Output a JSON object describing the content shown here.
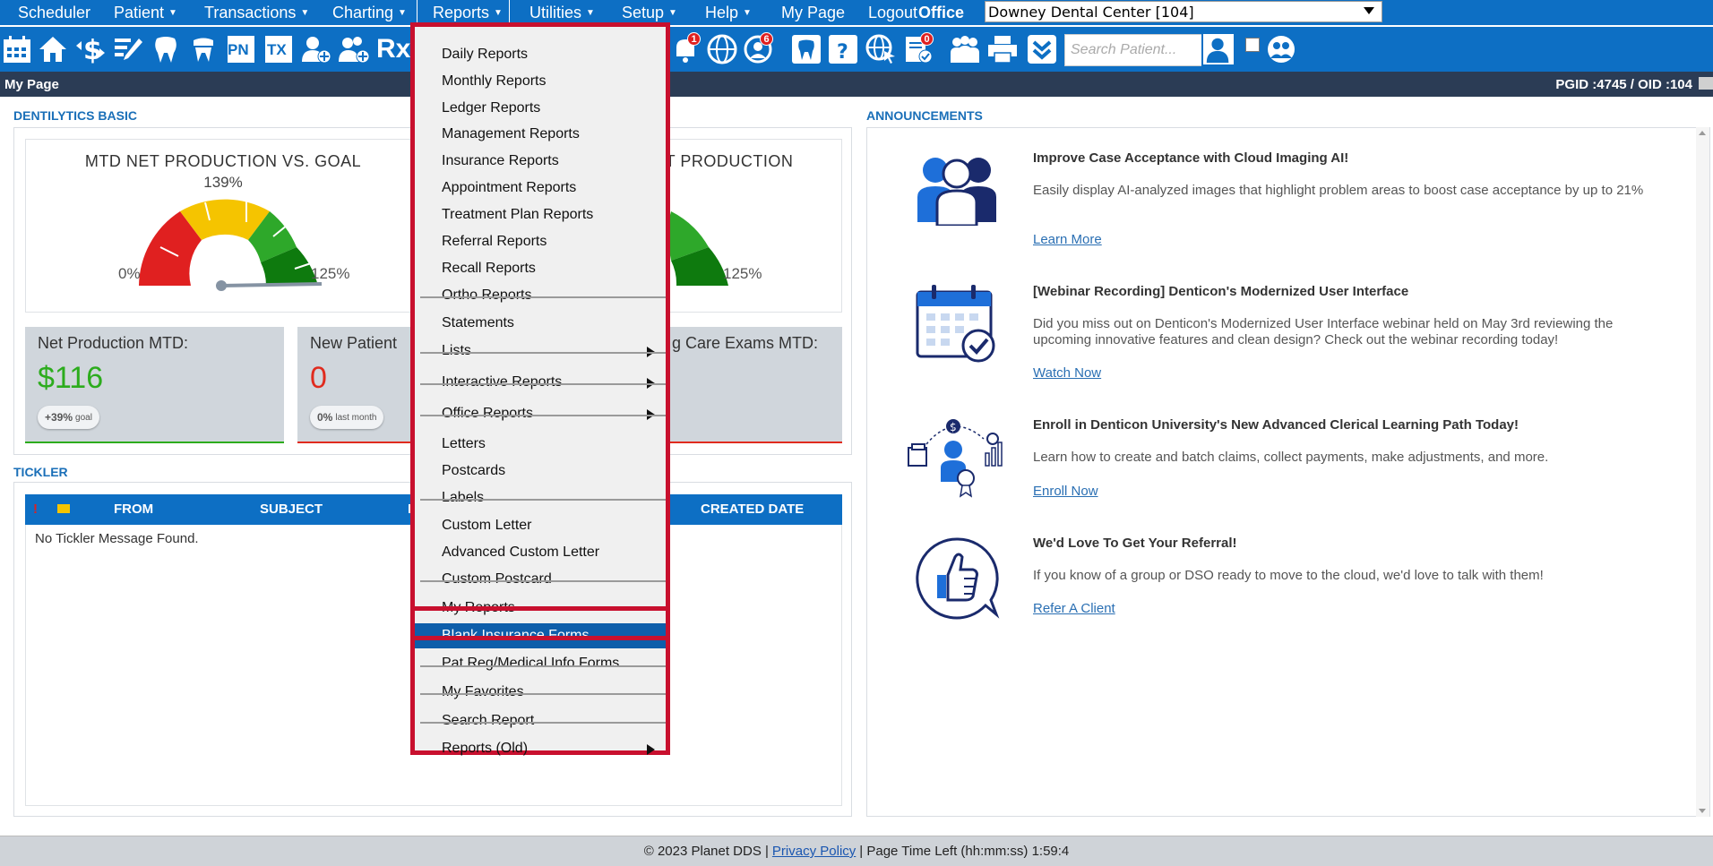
{
  "nav": {
    "items": [
      {
        "label": "Scheduler",
        "caret": false
      },
      {
        "label": "Patient",
        "caret": true
      },
      {
        "label": "Transactions",
        "caret": true
      },
      {
        "label": "Charting",
        "caret": true
      },
      {
        "label": "Reports",
        "caret": true
      },
      {
        "label": "Utilities",
        "caret": true
      },
      {
        "label": "Setup",
        "caret": true
      },
      {
        "label": "Help",
        "caret": true
      },
      {
        "label": "My Page",
        "caret": false
      },
      {
        "label": "Logout",
        "caret": false
      }
    ],
    "office_label": "Office",
    "office_value": "Downey Dental Center [104]"
  },
  "toolbar": {
    "search_placeholder": "Search Patient...",
    "badges": {
      "notifications": "1",
      "tasks": "6",
      "docs": "0"
    },
    "text_icons": {
      "pn": "PN",
      "tx": "TX",
      "rx": "Rx"
    }
  },
  "pagebar": {
    "title": "My Page",
    "ids": "PGID :4745  /  OID :104"
  },
  "dentilytics": {
    "section_title": "DENTILYTICS BASIC",
    "gauge1": {
      "title": "MTD NET PRODUCTION VS. GOAL",
      "percent": "139%",
      "min_label": "0%",
      "max_label": "125%"
    },
    "gauge2": {
      "title": "NET PRODUCTION",
      "max_label": "125%"
    },
    "kpis": [
      {
        "label": "Net Production MTD:",
        "value": "$116",
        "pill_main": "+39%",
        "pill_sub": "goal"
      },
      {
        "label": "New Patient",
        "value": "0",
        "pill_main": "0%",
        "pill_sub": "last month"
      },
      {
        "label": "g Care Exams MTD:"
      }
    ]
  },
  "tickler": {
    "section_title": "TICKLER",
    "columns": {
      "from": "FROM",
      "subject": "SUBJECT",
      "col3": "I",
      "created": "CREATED DATE"
    },
    "alert_icon": "!",
    "empty_message": "No Tickler Message Found."
  },
  "announcements": {
    "section_title": "ANNOUNCEMENTS",
    "items": [
      {
        "title": "Improve Case Acceptance with Cloud Imaging AI!",
        "text": "Easily display AI-analyzed images that highlight problem areas to boost case acceptance by up to 21%",
        "link": "Learn More"
      },
      {
        "title": "[Webinar Recording] Denticon's Modernized User Interface",
        "text": "Did you miss out on Denticon's Modernized User Interface webinar held on May 3rd reviewing the upcoming innovative features and clean design? Check out the webinar recording today!",
        "link": "Watch Now"
      },
      {
        "title": "Enroll in Denticon University's New Advanced Clerical Learning Path Today!",
        "text": "Learn how to create and batch claims, collect payments, make adjustments, and more.",
        "link": "Enroll Now"
      },
      {
        "title": "We'd Love To Get Your Referral!",
        "text": "If you know of a group or DSO ready to move to the cloud, we'd love to talk with them!",
        "link": "Refer A Client"
      }
    ]
  },
  "reports_menu": {
    "items": [
      {
        "label": "Daily Reports",
        "sub": false
      },
      {
        "label": "Monthly Reports",
        "sub": false
      },
      {
        "label": "Ledger Reports",
        "sub": false
      },
      {
        "label": "Management Reports",
        "sub": false
      },
      {
        "label": "Insurance Reports",
        "sub": false
      },
      {
        "label": "Appointment Reports",
        "sub": false
      },
      {
        "label": "Treatment Plan Reports",
        "sub": false
      },
      {
        "label": "Referral Reports",
        "sub": false
      },
      {
        "label": "Recall Reports",
        "sub": false
      },
      {
        "label": "Ortho Reports",
        "sub": false
      },
      {
        "label": "Statements",
        "sub": false
      },
      {
        "label": "Lists",
        "sub": true
      },
      {
        "label": "Interactive Reports",
        "sub": true
      },
      {
        "label": "Office Reports",
        "sub": true
      },
      {
        "label": "Letters",
        "sub": false
      },
      {
        "label": "Postcards",
        "sub": false
      },
      {
        "label": "Labels",
        "sub": false
      },
      {
        "label": "Custom Letter",
        "sub": false
      },
      {
        "label": "Advanced Custom Letter",
        "sub": false
      },
      {
        "label": "Custom Postcard",
        "sub": false
      },
      {
        "label": "My Reports",
        "sub": false
      },
      {
        "label": "Blank Insurance Forms",
        "sub": false,
        "highlighted": true
      },
      {
        "label": "Pat Reg/Medical Info Forms",
        "sub": false
      },
      {
        "label": "My Favorites",
        "sub": false
      },
      {
        "label": "Search Report",
        "sub": false
      },
      {
        "label": "Reports (Old)",
        "sub": true
      }
    ]
  },
  "footer": {
    "copyright": "© 2023 Planet DDS |",
    "privacy": "Privacy Policy",
    "time_left": "|  Page Time Left (hh:mm:ss) 1:59:4"
  },
  "colors": {
    "nav_blue": "#0d6fc4",
    "menu_highlight": "#0e5eaa",
    "red_outline": "#c8102e",
    "kpi_green": "#2cac1d",
    "kpi_red": "#e02b1e"
  }
}
